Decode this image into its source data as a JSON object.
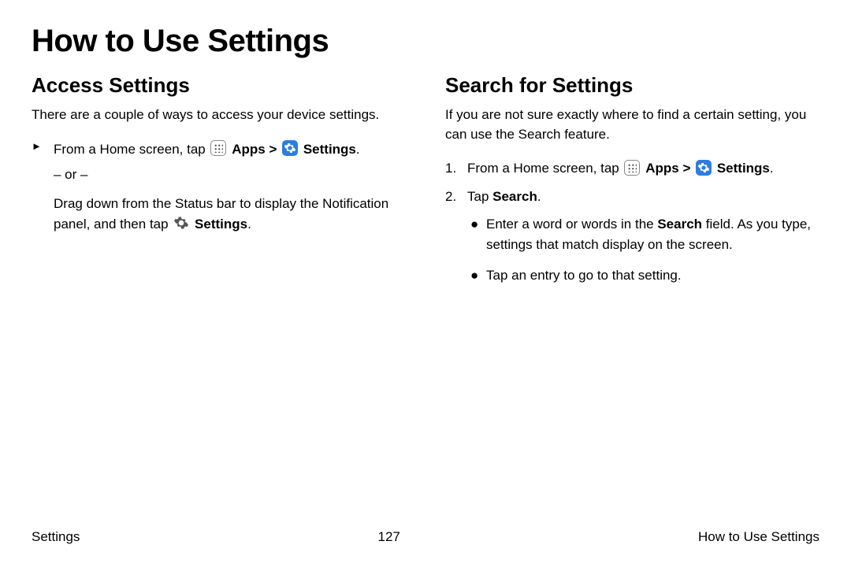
{
  "title": "How to Use Settings",
  "left": {
    "heading": "Access Settings",
    "intro": "There are a couple of ways to access your device settings.",
    "step1_pre": "From a Home screen, tap ",
    "apps_label": "Apps",
    "caret": " > ",
    "settings_label": "Settings",
    "period": ".",
    "or": "– or –",
    "sub_pre": "Drag down from the Status bar to display the Notification panel, and then tap ",
    "sub_bold": "Settings",
    "sub_post": "."
  },
  "right": {
    "heading": "Search for Settings",
    "intro": "If you are not sure exactly where to find a certain setting, you can use the Search feature.",
    "step1_marker": "1.",
    "step1_pre": "From a Home screen, tap ",
    "apps_label": "Apps",
    "caret": " > ",
    "settings_label": "Settings",
    "period": ".",
    "step2_marker": "2.",
    "step2_pre": "Tap ",
    "step2_bold": "Search",
    "step2_post": ".",
    "bullet1_pre": "Enter a word or words in the ",
    "bullet1_bold": "Search",
    "bullet1_post": " field. As you type, settings that match display on the screen.",
    "bullet2": "Tap an entry to go to that setting."
  },
  "footer": {
    "left": "Settings",
    "center": "127",
    "right": "How to Use Settings"
  },
  "markers": {
    "play": "►",
    "bullet": "●"
  }
}
